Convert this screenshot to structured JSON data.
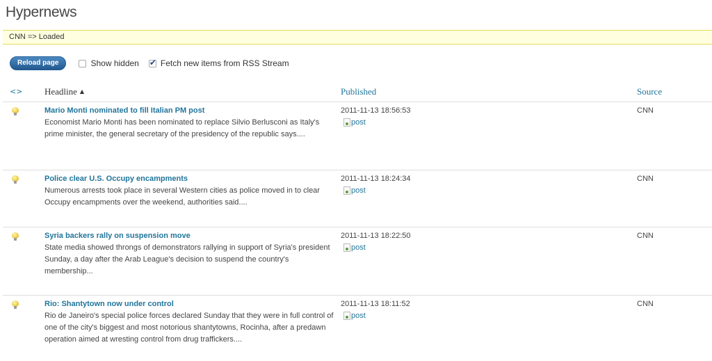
{
  "page": {
    "title": "Hypernews"
  },
  "notice": {
    "text": "CNN => Loaded"
  },
  "toolbar": {
    "reload_label": "Reload page",
    "show_hidden_label": "Show hidden",
    "show_hidden_checked": false,
    "fetch_label": "Fetch new items from RSS Stream",
    "fetch_checked": true
  },
  "table": {
    "columns": {
      "icon": "<>",
      "headline": "Headline",
      "published": "Published",
      "source": "Source"
    },
    "rows": [
      {
        "headline": "Mario Monti nominated to fill Italian PM post",
        "excerpt": "Economist Mario Monti has been nominated to replace Silvio Berlusconi as Italy's prime minister, the general secretary of the presidency of the republic says....",
        "published": "2011-11-13 18:56:53",
        "post_label": "post",
        "source": "CNN"
      },
      {
        "headline": "Police clear U.S. Occupy encampments",
        "excerpt": "Numerous arrests took place in several Western cities as police moved in to clear Occupy encampments over the weekend, authorities said....",
        "published": "2011-11-13 18:24:34",
        "post_label": "post",
        "source": "CNN"
      },
      {
        "headline": "Syria backers rally on suspension move",
        "excerpt": "State media showed throngs of demonstrators rallying in support of Syria's president Sunday, a day after the Arab League's decision to suspend the country's membership...",
        "published": "2011-11-13 18:22:50",
        "post_label": "post",
        "source": "CNN"
      },
      {
        "headline": "Rio: Shantytown now under control",
        "excerpt": "Rio de Janeiro's special police forces declared Sunday that they were in full control of one of the city's biggest and most notorious shantytowns, Rocinha, after a predawn operation aimed at wresting control from drug traffickers....",
        "published": "2011-11-13 18:11:52",
        "post_label": "post",
        "source": "CNN"
      }
    ]
  }
}
